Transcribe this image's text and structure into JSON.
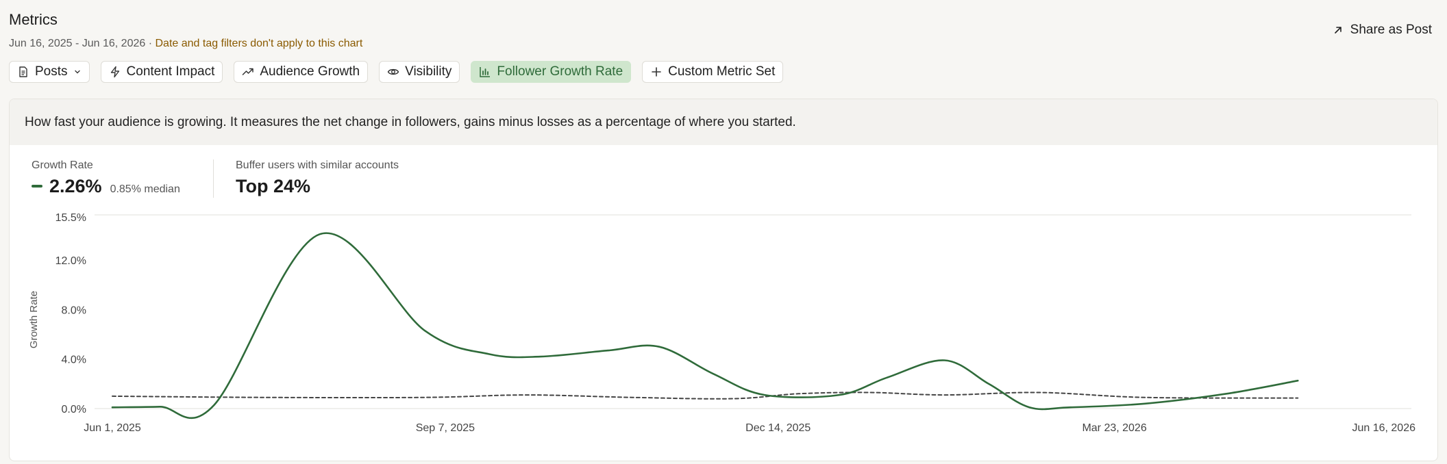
{
  "header": {
    "title": "Metrics",
    "date_range": "Jun 16, 2025 - Jun 16, 2026",
    "separator": " · ",
    "filter_note": "Date and tag filters don't apply to this chart",
    "share_label": "Share as Post"
  },
  "tabs": [
    {
      "label": "Posts",
      "icon": "document-icon",
      "dropdown": true
    },
    {
      "label": "Content Impact",
      "icon": "lightning-icon"
    },
    {
      "label": "Audience Growth",
      "icon": "trending-up-icon"
    },
    {
      "label": "Visibility",
      "icon": "eye-icon"
    },
    {
      "label": "Follower Growth Rate",
      "icon": "bar-chart-icon",
      "active": true
    },
    {
      "label": "Custom Metric Set",
      "icon": "plus-icon"
    }
  ],
  "card": {
    "description": "How fast your audience is growing. It measures the net change in followers, gains minus losses as a percentage of where you started.",
    "stats": {
      "growth": {
        "label": "Growth Rate",
        "value": "2.26%",
        "sub": "0.85% median"
      },
      "peers": {
        "label": "Buffer users with similar accounts",
        "value": "Top 24%"
      }
    }
  },
  "colors": {
    "accent": "#2f6b3a",
    "active_tab_bg": "#cfe6cd",
    "note": "#8a5a00",
    "median_line": "#444444"
  },
  "chart_data": {
    "type": "line",
    "ylabel": "Growth Rate",
    "ylim": [
      0,
      15.5
    ],
    "y_ticks": [
      {
        "value": 0,
        "label": "0.0%"
      },
      {
        "value": 4,
        "label": "4.0%"
      },
      {
        "value": 8,
        "label": "8.0%"
      },
      {
        "value": 12,
        "label": "12.0%"
      },
      {
        "value": 15.5,
        "label": "15.5%"
      }
    ],
    "xlim": [
      "2025-06-01",
      "2026-06-16"
    ],
    "x_ticks": [
      {
        "date": "2025-06-01",
        "label": "Jun 1, 2025"
      },
      {
        "date": "2025-09-07",
        "label": "Sep 7, 2025"
      },
      {
        "date": "2025-12-14",
        "label": "Dec 14, 2025"
      },
      {
        "date": "2026-03-23",
        "label": "Mar 23, 2026"
      },
      {
        "date": "2026-06-16",
        "label": "Jun 16, 2026"
      }
    ],
    "grid": "y-top-and-baseline",
    "series": [
      {
        "name": "Growth Rate",
        "style": "solid",
        "points": [
          [
            "2025-06-01",
            0.1
          ],
          [
            "2025-06-15",
            0.15
          ],
          [
            "2025-07-01",
            0.3
          ],
          [
            "2025-08-01",
            14.1
          ],
          [
            "2025-09-01",
            6.3
          ],
          [
            "2025-09-20",
            4.4
          ],
          [
            "2025-10-05",
            4.2
          ],
          [
            "2025-10-25",
            4.7
          ],
          [
            "2025-11-09",
            5.0
          ],
          [
            "2025-11-25",
            2.8
          ],
          [
            "2025-12-10",
            1.1
          ],
          [
            "2026-01-01",
            1.1
          ],
          [
            "2026-01-15",
            2.5
          ],
          [
            "2026-02-01",
            3.9
          ],
          [
            "2026-02-14",
            2.0
          ],
          [
            "2026-02-26",
            0.1
          ],
          [
            "2026-03-10",
            0.1
          ],
          [
            "2026-04-01",
            0.4
          ],
          [
            "2026-04-25",
            1.2
          ],
          [
            "2026-05-16",
            2.26
          ]
        ]
      },
      {
        "name": "0.85% median",
        "style": "dashed",
        "points": [
          [
            "2025-06-01",
            1.0
          ],
          [
            "2025-07-15",
            0.9
          ],
          [
            "2025-09-01",
            0.9
          ],
          [
            "2025-10-01",
            1.1
          ],
          [
            "2025-11-01",
            0.9
          ],
          [
            "2025-12-01",
            0.8
          ],
          [
            "2025-12-20",
            1.2
          ],
          [
            "2026-01-10",
            1.3
          ],
          [
            "2026-02-01",
            1.1
          ],
          [
            "2026-03-01",
            1.3
          ],
          [
            "2026-04-01",
            0.9
          ],
          [
            "2026-05-16",
            0.85
          ]
        ]
      }
    ]
  }
}
